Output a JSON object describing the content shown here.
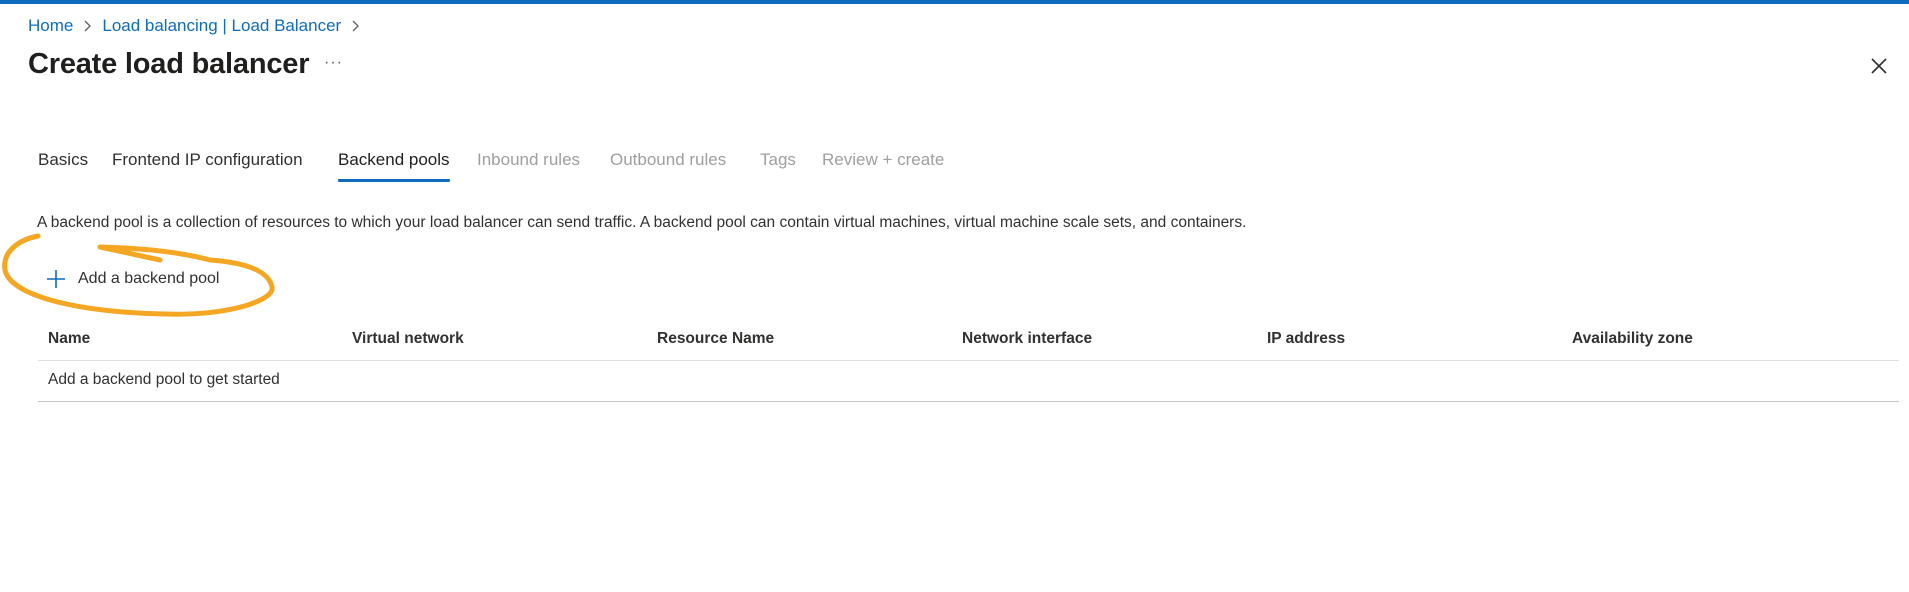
{
  "colors": {
    "accent": "#0f6cbd",
    "highlight_annotation": "#f5a623"
  },
  "breadcrumb": {
    "items": [
      {
        "label": "Home"
      },
      {
        "label": "Load balancing | Load Balancer"
      }
    ]
  },
  "page": {
    "title": "Create load balancer",
    "more_icon": "ellipsis-icon",
    "close_icon": "close-icon"
  },
  "tabs": [
    {
      "label": "Basics",
      "state": "enabled"
    },
    {
      "label": "Frontend IP configuration",
      "state": "enabled"
    },
    {
      "label": "Backend pools",
      "state": "active"
    },
    {
      "label": "Inbound rules",
      "state": "disabled"
    },
    {
      "label": "Outbound rules",
      "state": "disabled"
    },
    {
      "label": "Tags",
      "state": "disabled"
    },
    {
      "label": "Review + create",
      "state": "disabled"
    }
  ],
  "main": {
    "description": "A backend pool is a collection of resources to which your load balancer can send traffic. A backend pool can contain virtual machines, virtual machine scale sets, and containers.",
    "add_button": {
      "label": "Add a backend pool",
      "icon": "plus-icon"
    },
    "table": {
      "columns": [
        "Name",
        "Virtual network",
        "Resource Name",
        "Network interface",
        "IP address",
        "Availability zone"
      ],
      "empty_message": "Add a backend pool to get started"
    }
  }
}
